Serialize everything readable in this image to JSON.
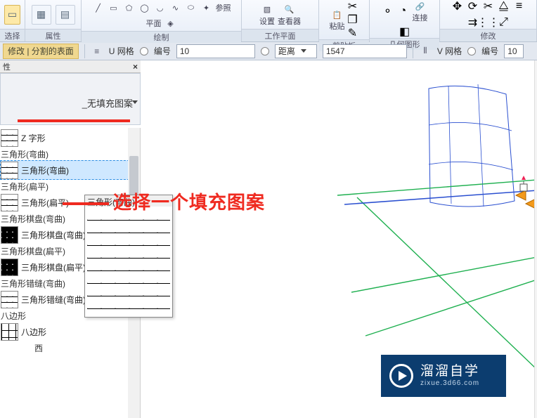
{
  "ribbon": {
    "groups": {
      "select": {
        "label": "选择"
      },
      "props": {
        "label": "属性"
      },
      "draw": {
        "label": "绘制",
        "tool_ref": "参照",
        "tool_plane": "平面"
      },
      "workplane": {
        "label": "工作平面",
        "btn_set": "设置",
        "btn_viewer": "查看器"
      },
      "clipboard": {
        "label": "剪贴板",
        "paste": "粘贴"
      },
      "geometry": {
        "label": "几何图形",
        "connect": "连接"
      },
      "modify": {
        "label": "修改"
      }
    }
  },
  "optionsbar": {
    "tab_label": "修改 | 分割的表面",
    "u_label": "U 网格",
    "num_label_u": "编号",
    "u_value": "10",
    "dist_label": "距离",
    "dist_value": "1547",
    "v_label": "V 网格",
    "num_label_v": "编号",
    "v_value": "10"
  },
  "panel": {
    "title": "性",
    "type_name": "_无填充图案"
  },
  "tree": {
    "items": [
      {
        "kind": "item",
        "thumb": "line",
        "label": "Z 字形"
      },
      {
        "kind": "group",
        "label": "三角形(弯曲)"
      },
      {
        "kind": "item",
        "thumb": "line",
        "label": "三角形(弯曲)",
        "selected": true
      },
      {
        "kind": "group",
        "label": "三角形(扁平)"
      },
      {
        "kind": "item",
        "thumb": "line",
        "label": "三角形(扁平)"
      },
      {
        "kind": "group",
        "label": "三角形棋盘(弯曲)"
      },
      {
        "kind": "item",
        "thumb": "solid",
        "label": "三角形棋盘(弯曲)"
      },
      {
        "kind": "group",
        "label": "三角形棋盘(扁平)"
      },
      {
        "kind": "item",
        "thumb": "solid",
        "label": "三角形棋盘(扁平)"
      },
      {
        "kind": "group",
        "label": "三角形错缝(弯曲)"
      },
      {
        "kind": "item",
        "thumb": "line",
        "label": "三角形错缝(弯曲)"
      },
      {
        "kind": "group",
        "label": "八边形"
      },
      {
        "kind": "item",
        "thumb": "octa",
        "label": "八边形"
      },
      {
        "kind": "sub",
        "label": "西"
      }
    ]
  },
  "popup": {
    "title": "三角形(弯曲)"
  },
  "annotation": "选择一个填充图案",
  "watermark": {
    "name": "溜溜自学",
    "domain": "zixue.3d66.com"
  }
}
